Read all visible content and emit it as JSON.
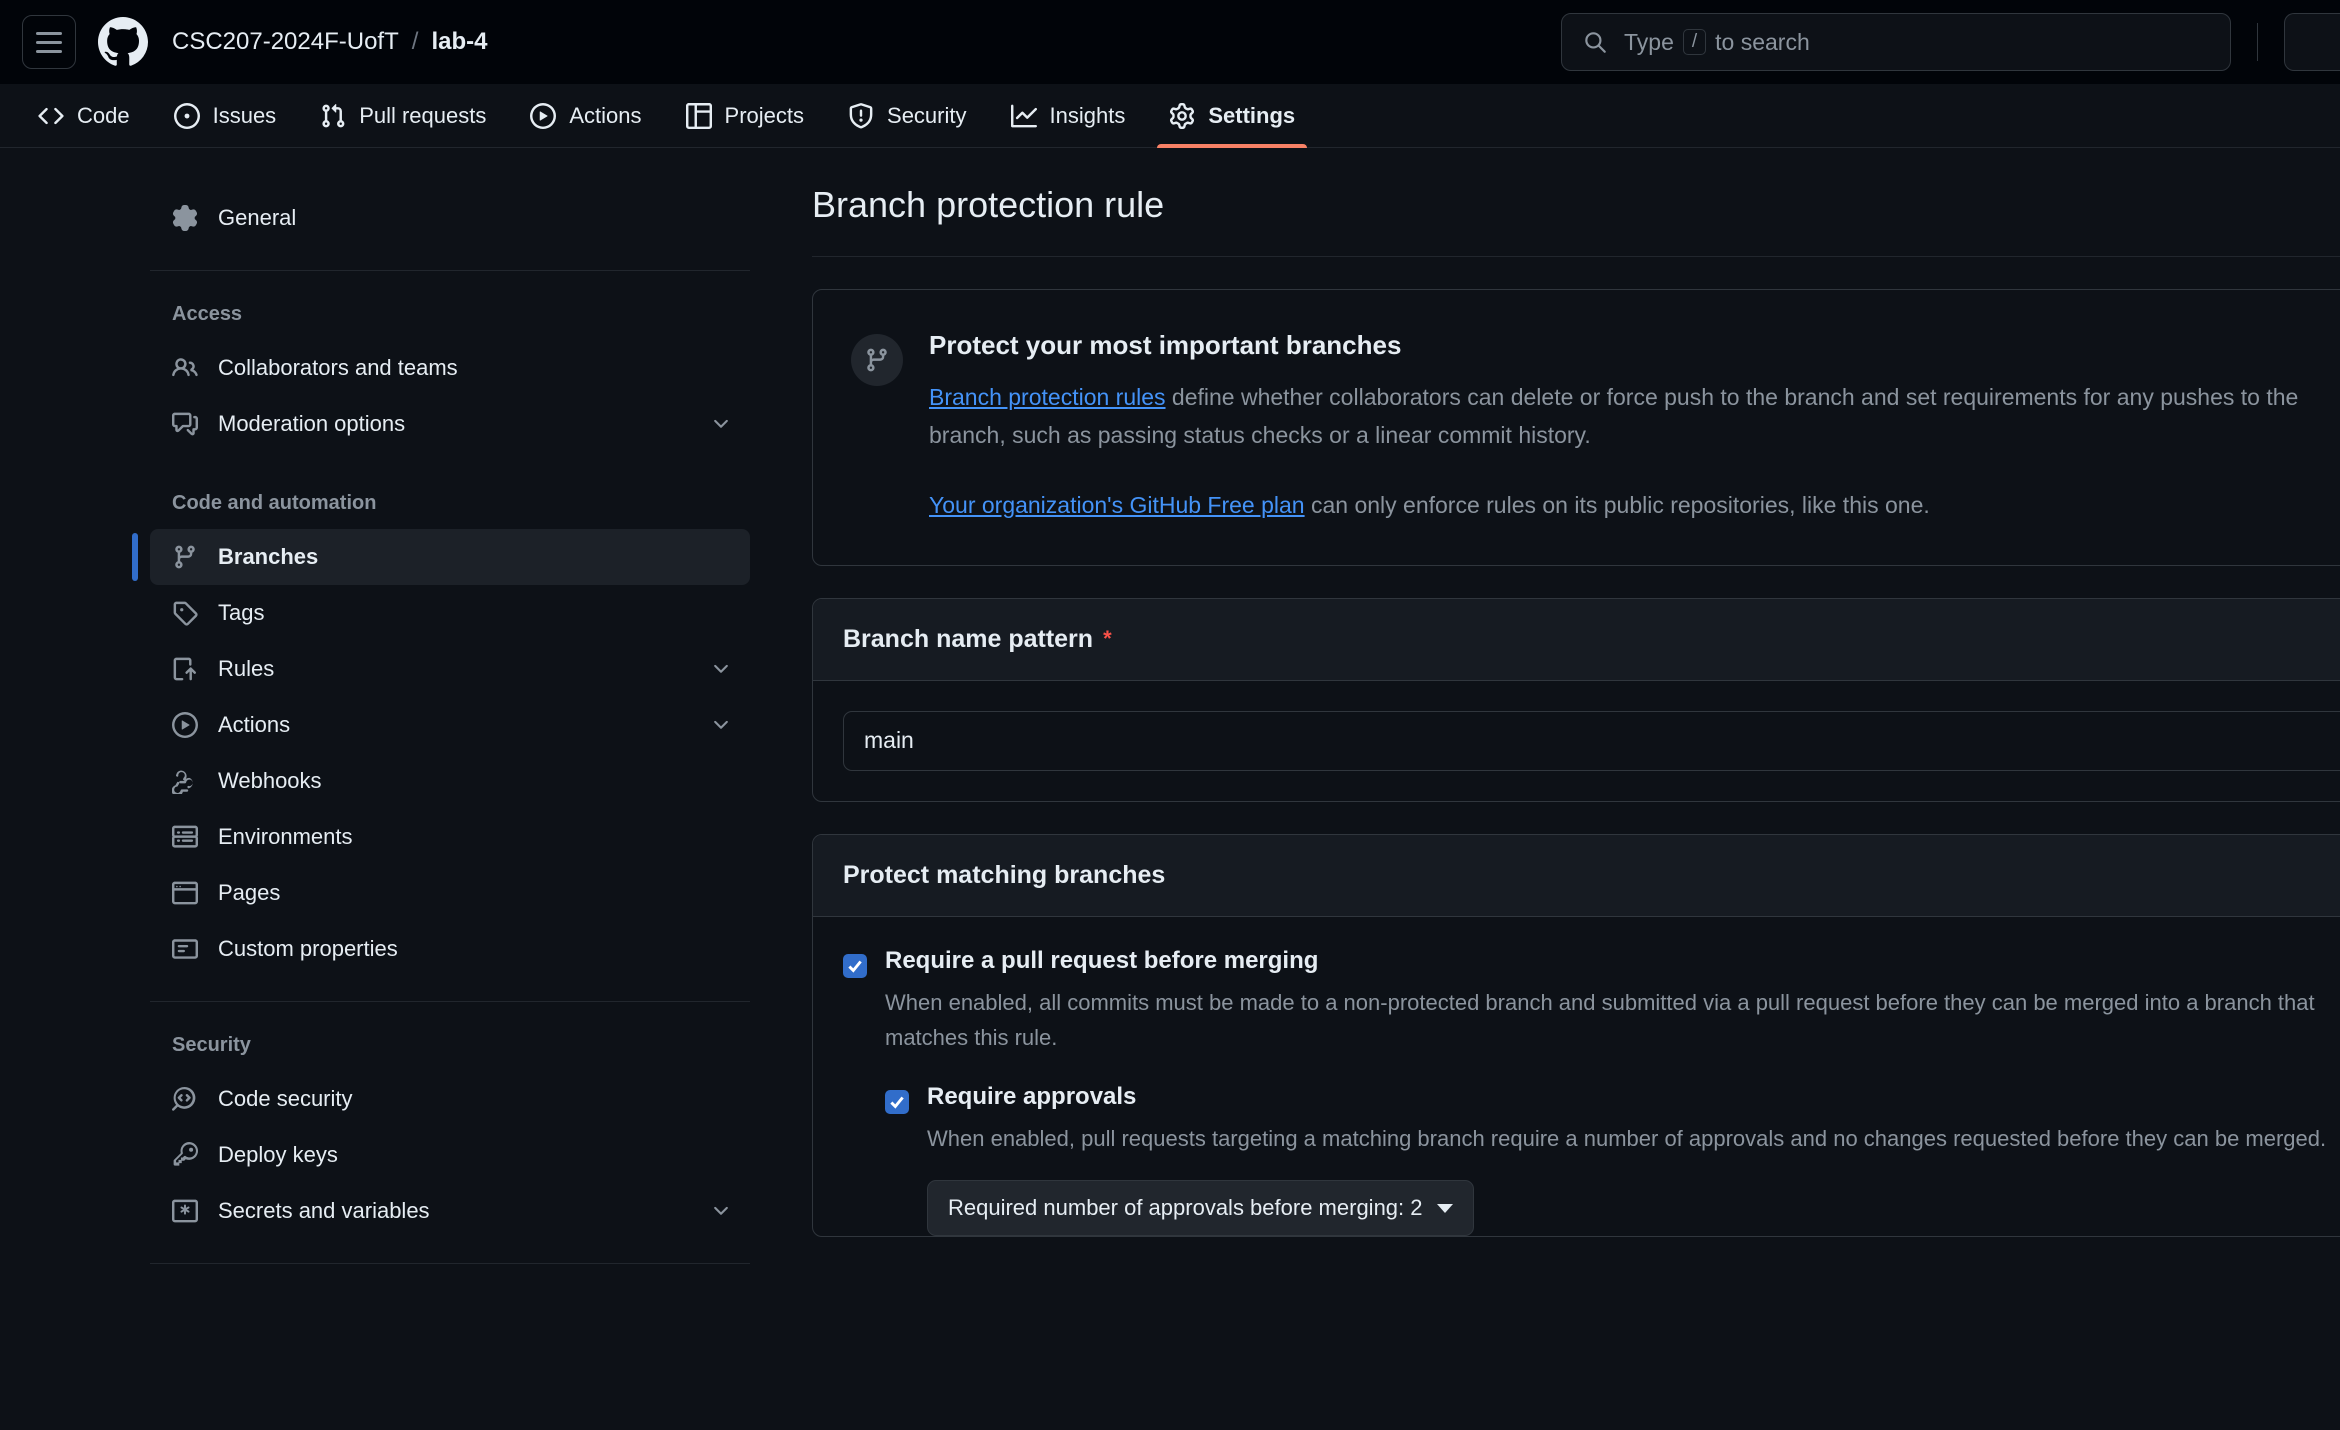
{
  "header": {
    "menu_icon": "hamburger-icon",
    "logo_icon": "github-logo-icon",
    "owner": "CSC207-2024F-UofT",
    "separator": "/",
    "repo": "lab-4",
    "search": {
      "icon": "search-icon",
      "placeholder_prefix": "Type",
      "key_hint": "/",
      "placeholder_suffix": "to search"
    }
  },
  "repo_nav": {
    "tabs": [
      {
        "label": "Code",
        "icon": "code-icon",
        "active": false
      },
      {
        "label": "Issues",
        "icon": "issue-opened-icon",
        "active": false
      },
      {
        "label": "Pull requests",
        "icon": "git-pull-request-icon",
        "active": false
      },
      {
        "label": "Actions",
        "icon": "play-icon",
        "active": false
      },
      {
        "label": "Projects",
        "icon": "table-icon",
        "active": false
      },
      {
        "label": "Security",
        "icon": "shield-icon",
        "active": false
      },
      {
        "label": "Insights",
        "icon": "graph-icon",
        "active": false
      },
      {
        "label": "Settings",
        "icon": "gear-icon",
        "active": true
      }
    ],
    "active_underline_color": "#f78166"
  },
  "sidebar": {
    "top_items": [
      {
        "label": "General",
        "icon": "gear-icon"
      }
    ],
    "sections": [
      {
        "heading": "Access",
        "items": [
          {
            "label": "Collaborators and teams",
            "icon": "people-icon",
            "expandable": false
          },
          {
            "label": "Moderation options",
            "icon": "comment-discussion-icon",
            "expandable": true
          }
        ]
      },
      {
        "heading": "Code and automation",
        "items": [
          {
            "label": "Branches",
            "icon": "git-branch-icon",
            "expandable": false,
            "active": true
          },
          {
            "label": "Tags",
            "icon": "tag-icon",
            "expandable": false
          },
          {
            "label": "Rules",
            "icon": "rules-icon",
            "expandable": true
          },
          {
            "label": "Actions",
            "icon": "play-icon",
            "expandable": true
          },
          {
            "label": "Webhooks",
            "icon": "webhook-icon",
            "expandable": false
          },
          {
            "label": "Environments",
            "icon": "server-icon",
            "expandable": false
          },
          {
            "label": "Pages",
            "icon": "browser-icon",
            "expandable": false
          },
          {
            "label": "Custom properties",
            "icon": "note-icon",
            "expandable": false
          }
        ]
      },
      {
        "heading": "Security",
        "items": [
          {
            "label": "Code security",
            "icon": "codescan-icon",
            "expandable": false
          },
          {
            "label": "Deploy keys",
            "icon": "key-icon",
            "expandable": false
          },
          {
            "label": "Secrets and variables",
            "icon": "asterisk-key-icon",
            "expandable": true
          }
        ]
      }
    ],
    "active_indicator_color": "#316dca"
  },
  "main": {
    "title": "Branch protection rule",
    "banner": {
      "icon": "git-branch-icon",
      "title": "Protect your most important branches",
      "p1_link": "Branch protection rules",
      "p1_text": " define whether collaborators can delete or force push to the branch and set requirements for any pushes to the branch, such as passing status checks or a linear commit history.",
      "p2_link": "Your organization's GitHub Free plan",
      "p2_text": " can only enforce rules on its public repositories, like this one."
    },
    "pattern_card": {
      "label": "Branch name pattern",
      "required_marker": "*",
      "input_value": "main",
      "input_placeholder": "Branch name pattern"
    },
    "protect_card": {
      "header": "Protect matching branches",
      "options": [
        {
          "label": "Require a pull request before merging",
          "checked": true,
          "description": "When enabled, all commits must be made to a non-protected branch and submitted via a pull request before they can be merged into a branch that matches this rule."
        }
      ],
      "nested_option": {
        "label": "Require approvals",
        "checked": true,
        "description": "When enabled, pull requests targeting a matching branch require a number of approvals and no changes requested before they can be merged.",
        "select_label": "Required number of approvals before merging: 2"
      }
    }
  },
  "colors": {
    "page_bg": "#0d1117",
    "header_bg": "#010409",
    "accent_link": "#4493f8",
    "accent_check": "#316dca",
    "accent_tab": "#f78166",
    "required": "#f85149"
  }
}
